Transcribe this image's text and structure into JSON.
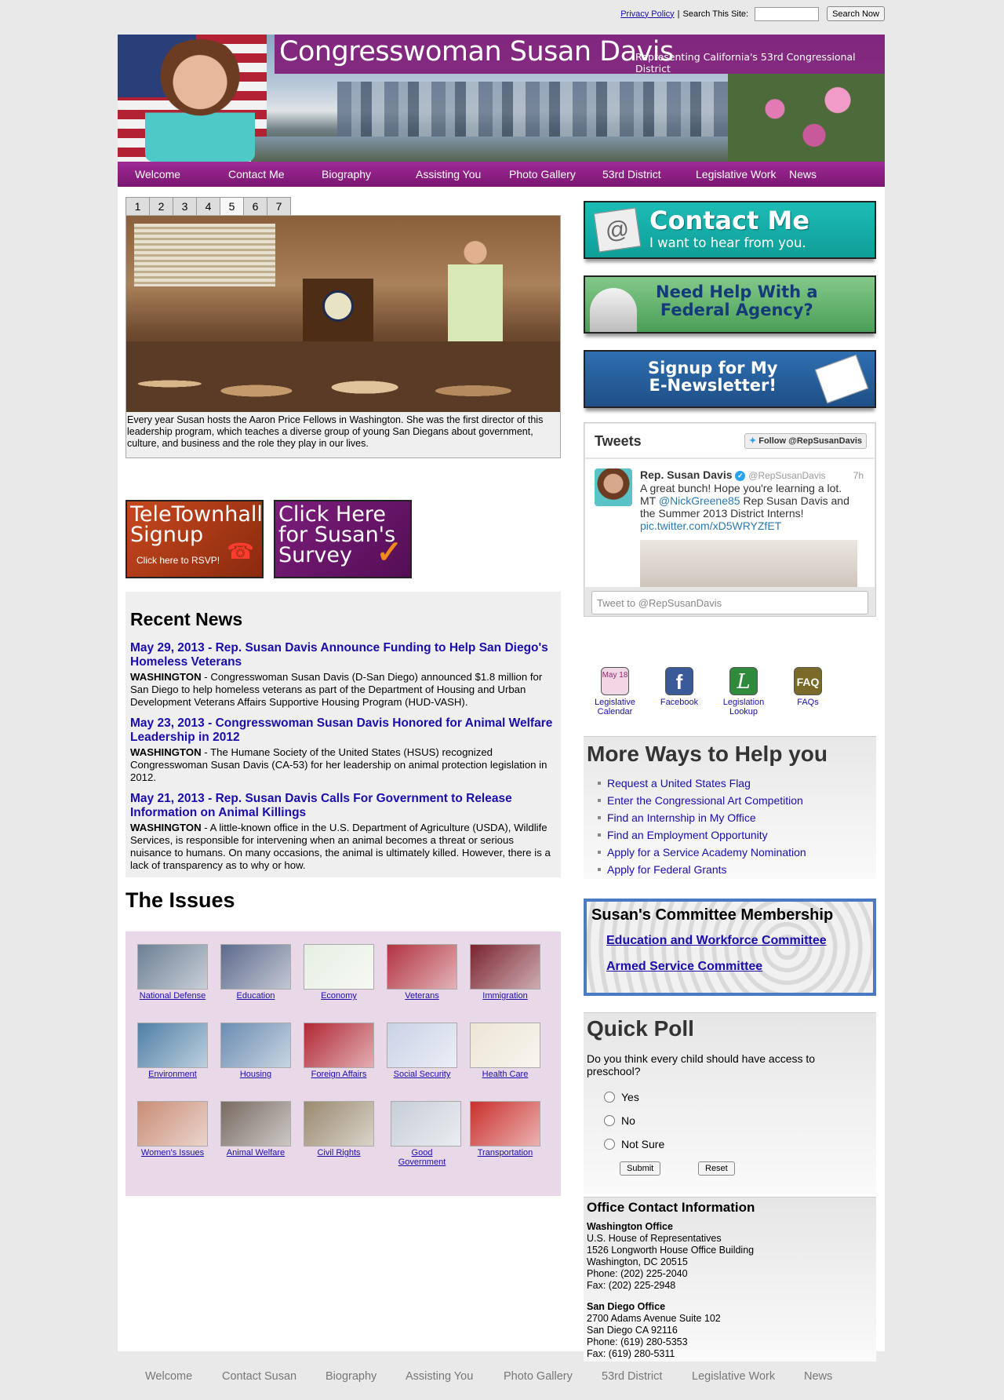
{
  "topbar": {
    "privacy_label": "Privacy Policy",
    "separator": "|",
    "search_label": "Search This Site:",
    "search_value": "",
    "search_button": "Search Now"
  },
  "banner": {
    "title": "Congresswoman Susan Davis",
    "subtitle": "Representing California's 53rd Congressional District"
  },
  "nav": [
    "Welcome",
    "Contact Me",
    "Biography",
    "Assisting You",
    "Photo Gallery",
    "53rd District",
    "Legislative Work",
    "News"
  ],
  "slideshow": {
    "tabs": [
      "1",
      "2",
      "3",
      "4",
      "5",
      "6",
      "7"
    ],
    "active_tab": "5",
    "caption": "Every year Susan hosts the Aaron Price Fellows in Washington. She was the first director of this leadership program, which teaches a diverse group of young San Diegans about government, culture, and business and the role they play in our lives."
  },
  "promos": {
    "tele_title": "TeleTownhall Signup",
    "tele_sub": "Click here to RSVP!",
    "survey_title": "Click Here for Susan's Survey"
  },
  "news": {
    "heading": "Recent News",
    "items": [
      {
        "title": "May 29, 2013 - Rep. Susan Davis Announce Funding to Help San Diego's Homeless Veterans",
        "dateline": "WASHINGTON",
        "text": " - Congresswoman Susan Davis (D-San Diego) announced $1.8 million for San Diego to help homeless veterans as part of the Department of Housing and Urban Development Veterans Affairs Supportive Housing Program (HUD-VASH)."
      },
      {
        "title": "May 23, 2013 - Congresswoman Susan Davis Honored for Animal Welfare Leadership in 2012",
        "dateline": "WASHINGTON",
        "text": " - The Humane Society of the United States (HSUS) recognized Congresswoman Susan Davis (CA-53) for her leadership on animal protection legislation in 2012."
      },
      {
        "title": "May 21, 2013 - Rep. Susan Davis Calls For Government to Release Information on Animal Killings",
        "dateline": "WASHINGTON",
        "text": " - A little-known office in the U.S. Department of Agriculture (USDA), Wildlife Services, is responsible for intervening when an animal becomes a threat or serious nuisance to humans.  On many occasions, the animal is ultimately killed. However, there is a lack of transparency as to why or how."
      }
    ]
  },
  "issues": {
    "heading": "The Issues",
    "items": [
      {
        "label": "National Defense",
        "color": "#6d7f95"
      },
      {
        "label": "Education",
        "color": "#5d6a8c"
      },
      {
        "label": "Economy",
        "color": "#e7efe2"
      },
      {
        "label": "Veterans",
        "color": "#b23340"
      },
      {
        "label": "Immigration",
        "color": "#7a2430"
      },
      {
        "label": "Environment",
        "color": "#4f7fa6"
      },
      {
        "label": "Housing",
        "color": "#6b8db2"
      },
      {
        "label": "Foreign Affairs",
        "color": "#b12834"
      },
      {
        "label": "Social Security",
        "color": "#c9d2e6"
      },
      {
        "label": "Health Care",
        "color": "#ede5d5"
      },
      {
        "label": "Women's Issues",
        "color": "#c98d76"
      },
      {
        "label": "Animal Welfare",
        "color": "#786b62"
      },
      {
        "label": "Civil Rights",
        "color": "#9a8a6f"
      },
      {
        "label": "Good Government",
        "color": "#c7ced8"
      },
      {
        "label": "Transportation",
        "color": "#c9302c"
      }
    ]
  },
  "cta": {
    "contact_main": "Contact Me",
    "contact_sub": "I want to hear from you.",
    "agency_line1": "Need Help With a",
    "agency_line2": "Federal Agency?",
    "news_line1": "Signup for My",
    "news_line2": "E-Newsletter!"
  },
  "tweets": {
    "heading": "Tweets",
    "follow": "Follow @RepSusanDavis",
    "author": "Rep. Susan Davis",
    "handle": "@RepSusanDavis",
    "time": "7h",
    "text_a": "A great bunch! Hope you're learning a lot. MT ",
    "mention": "@NickGreene85",
    "text_b": " Rep Susan Davis and the Summer 2013 District Interns!",
    "link": "pic.twitter.com/xD5WRYZfET",
    "compose_placeholder": "Tweet to @RepSusanDavis"
  },
  "quick_icons": [
    {
      "label": "Legislative Calendar",
      "glyph": "May 18",
      "color": "#8c2a6e"
    },
    {
      "label": "Facebook",
      "glyph": "f",
      "color": "#3b5a9a"
    },
    {
      "label": "Legislation Lookup",
      "glyph": "L",
      "color": "#2f8a3c"
    },
    {
      "label": "FAQs",
      "glyph": "FAQ",
      "color": "#7a6a2a"
    }
  ],
  "ways": {
    "heading": "More Ways to Help you",
    "items": [
      "Request a United States Flag",
      "Enter the Congressional Art Competition",
      "Find an Internship in My Office",
      "Find an Employment Opportunity",
      "Apply for a Service Academy Nomination",
      "Apply for Federal Grants"
    ]
  },
  "committee": {
    "heading": "Susan's Committee Membership",
    "items": [
      "Education and Workforce Committee",
      "Armed Service Committee"
    ]
  },
  "poll": {
    "heading": "Quick Poll",
    "question": "Do you think every child should have access to preschool?",
    "options": [
      "Yes",
      "No",
      "Not Sure"
    ],
    "submit": "Submit",
    "reset": "Reset"
  },
  "office": {
    "heading": "Office Contact Information",
    "dc_name": "Washington Office",
    "dc_lines": [
      "U.S. House of Representatives",
      "1526 Longworth House Office Building",
      "Washington, DC 20515",
      "Phone: (202) 225-2040",
      "Fax: (202) 225-2948"
    ],
    "sd_name": "San Diego Office",
    "sd_lines": [
      "2700 Adams Avenue Suite 102",
      "San Diego CA 92116",
      "Phone: (619) 280-5353",
      "Fax: (619) 280-5311"
    ]
  },
  "footer": [
    "Welcome",
    "Contact Susan",
    "Biography",
    "Assisting You",
    "Photo Gallery",
    "53rd District",
    "Legislative Work",
    "News"
  ]
}
